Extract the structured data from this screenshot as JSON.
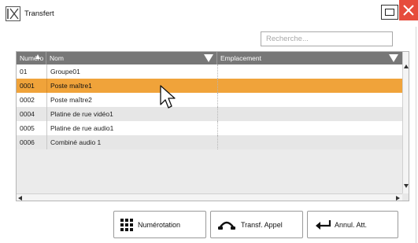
{
  "window": {
    "logo": "IX",
    "title": "Transfert",
    "maximize_icon": "maximize-icon",
    "close_icon": "close-icon",
    "close_color": "#e64c3c"
  },
  "search": {
    "placeholder": "Recherche...",
    "value": ""
  },
  "table": {
    "header_color": "#777777",
    "selected_color": "#f0a33a",
    "columns": [
      "Numéro",
      "Nom",
      "Emplacement"
    ],
    "rows": [
      {
        "num": "01",
        "name": "Groupe01",
        "location": ""
      },
      {
        "num": "0001",
        "name": "Poste maître1",
        "location": "",
        "selected": true
      },
      {
        "num": "0002",
        "name": "Poste maître2",
        "location": ""
      },
      {
        "num": "0004",
        "name": "Platine de rue vidéo1",
        "location": ""
      },
      {
        "num": "0005",
        "name": "Platine de rue audio1",
        "location": ""
      },
      {
        "num": "0006",
        "name": "Combiné audio 1",
        "location": ""
      }
    ]
  },
  "actions": [
    {
      "label": "Numérotation",
      "icon": "keypad-icon"
    },
    {
      "label": "Transf. Appel",
      "icon": "handset-icon"
    },
    {
      "label": "Annul. Att.",
      "icon": "return-arrow-icon"
    }
  ]
}
